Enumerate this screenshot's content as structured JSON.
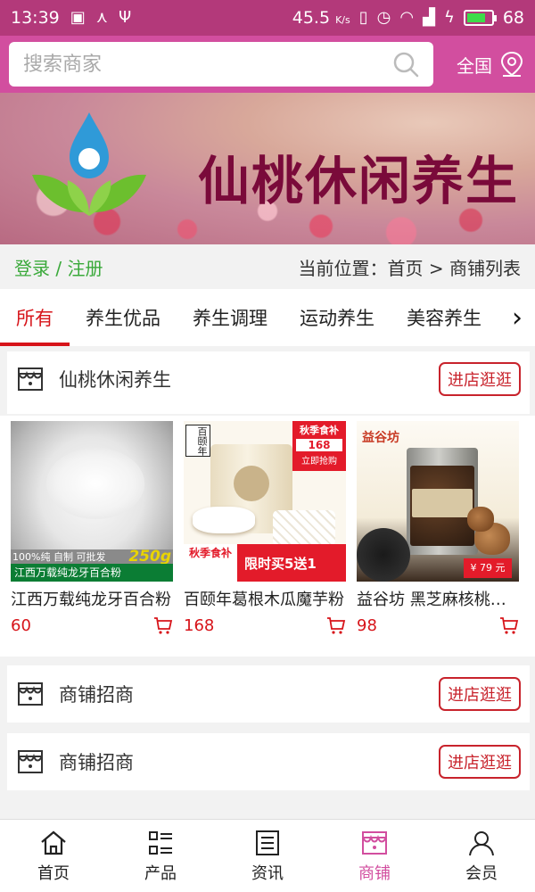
{
  "status_bar": {
    "time": "13:39",
    "net_speed": "45.5",
    "net_unit": "K/s",
    "battery": "68"
  },
  "search": {
    "placeholder": "搜索商家",
    "region_label": "全国"
  },
  "banner": {
    "title": "仙桃休闲养生"
  },
  "user": {
    "login": "登录",
    "separator": " / ",
    "register": "注册"
  },
  "breadcrumb": "当前位置：首页 > 商铺列表",
  "tabs": [
    {
      "label": "所有"
    },
    {
      "label": "养生优品"
    },
    {
      "label": "养生调理"
    },
    {
      "label": "运动养生"
    },
    {
      "label": "美容养生"
    }
  ],
  "shops": [
    {
      "name": "仙桃休闲养生",
      "button": "进店逛逛"
    },
    {
      "name": "商铺招商",
      "button": "进店逛逛"
    },
    {
      "name": "商铺招商",
      "button": "进店逛逛"
    }
  ],
  "products": [
    {
      "name": "江西万载纯龙牙百合粉",
      "price": "60",
      "img_caption": "江西万载纯龙牙百合粉",
      "img_tag": "100%纯 自制 可批发",
      "img_weight": "250g"
    },
    {
      "name": "百颐年葛根木瓜魔芋粉",
      "price": "168",
      "img_brand": "百颐年",
      "img_tag1": "秋季食补",
      "img_tag2": "限时买5送1",
      "img_badge": "秋季食补",
      "img_badge_price": "168",
      "img_badge_action": "立即抢购"
    },
    {
      "name": "益谷坊 黑芝麻核桃黑豆粉",
      "price": "98",
      "img_brand": "益谷坊",
      "img_price": "¥ 79 元"
    }
  ],
  "bottom_nav": [
    {
      "label": "首页",
      "icon": "home-icon"
    },
    {
      "label": "产品",
      "icon": "list-icon"
    },
    {
      "label": "资讯",
      "icon": "news-icon"
    },
    {
      "label": "商铺",
      "icon": "shop-icon",
      "active": true
    },
    {
      "label": "会员",
      "icon": "user-icon"
    }
  ],
  "colors": {
    "brand": "#d24e9f",
    "statusbar": "#b3397a",
    "accent_red": "#d7141a",
    "login_green": "#3aa93a"
  }
}
